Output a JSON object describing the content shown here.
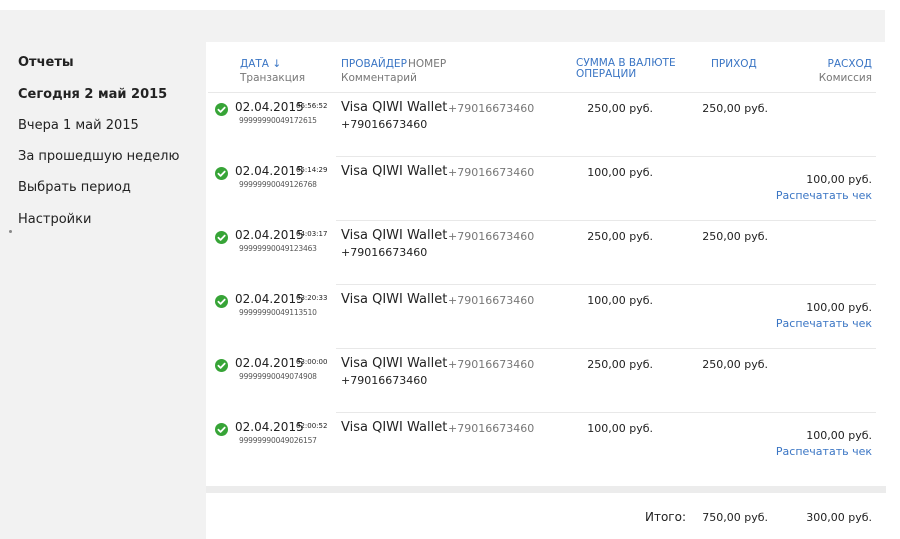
{
  "sidebar": {
    "items": [
      {
        "label": "Отчеты",
        "bold": true
      },
      {
        "label": "Сегодня 2 май 2015",
        "bold": true
      },
      {
        "label": "Вчера 1 май 2015",
        "bold": false
      },
      {
        "label": "За прошедшую неделю",
        "bold": false
      },
      {
        "label": "Выбрать период",
        "bold": false
      },
      {
        "label": "Настройки",
        "bold": false
      }
    ]
  },
  "table": {
    "headers": {
      "date": "ДАТА ↓",
      "date_sub": "Транзакция",
      "provider": "ПРОВАЙДЕР",
      "number": "НОМЕР",
      "provider_sub": "Комментарий",
      "amount_line1": "СУММА В ВАЛЮТЕ",
      "amount_line2": "ОПЕРАЦИИ",
      "income": "ПРИХОД",
      "expense": "РАСХОД",
      "expense_sub": "Комиссия"
    },
    "rows": [
      {
        "status_icon": "check-circle-icon",
        "date": "02.04.2015",
        "time": "06:56:52",
        "txn": "99999990049172615",
        "provider": "Visa QIWI Wallet",
        "number": "+79016673460",
        "comment": "+79016673460",
        "amount": "250,00 руб.",
        "income": "250,00 руб.",
        "expense": "",
        "action": ""
      },
      {
        "status_icon": "check-circle-icon",
        "date": "02.04.2015",
        "time": "05:14:29",
        "txn": "99999990049126768",
        "provider": "Visa QIWI Wallet",
        "number": "+79016673460",
        "comment": "",
        "amount": "100,00 руб.",
        "income": "",
        "expense": "100,00 руб.",
        "action": "Распечатать чек"
      },
      {
        "status_icon": "check-circle-icon",
        "date": "02.04.2015",
        "time": "04:03:17",
        "txn": "99999990049123463",
        "provider": "Visa QIWI Wallet",
        "number": "+79016673460",
        "comment": "+79016673460",
        "amount": "250,00 руб.",
        "income": "250,00 руб.",
        "expense": "",
        "action": ""
      },
      {
        "status_icon": "check-circle-icon",
        "date": "02.04.2015",
        "time": "03:20:33",
        "txn": "99999990049113510",
        "provider": "Visa QIWI Wallet",
        "number": "+79016673460",
        "comment": "",
        "amount": "100,00 руб.",
        "income": "",
        "expense": "100,00 руб.",
        "action": "Распечатать чек"
      },
      {
        "status_icon": "check-circle-icon",
        "date": "02.04.2015",
        "time": "03:00:00",
        "txn": "99999990049074908",
        "provider": "Visa QIWI Wallet",
        "number": "+79016673460",
        "comment": "+79016673460",
        "amount": "250,00 руб.",
        "income": "250,00 руб.",
        "expense": "",
        "action": ""
      },
      {
        "status_icon": "check-circle-icon",
        "date": "02.04.2015",
        "time": "02:00:52",
        "txn": "99999990049026157",
        "provider": "Visa QIWI Wallet",
        "number": "+79016673460",
        "comment": "",
        "amount": "100,00 руб.",
        "income": "",
        "expense": "100,00 руб.",
        "action": "Распечатать чек"
      }
    ]
  },
  "totals": {
    "label": "Итого:",
    "income": "750,00 руб.",
    "expense": "300,00 руб."
  },
  "colors": {
    "accent": "#3a75c4",
    "success": "#37a437",
    "sidebar_bg": "#f2f2f2"
  }
}
